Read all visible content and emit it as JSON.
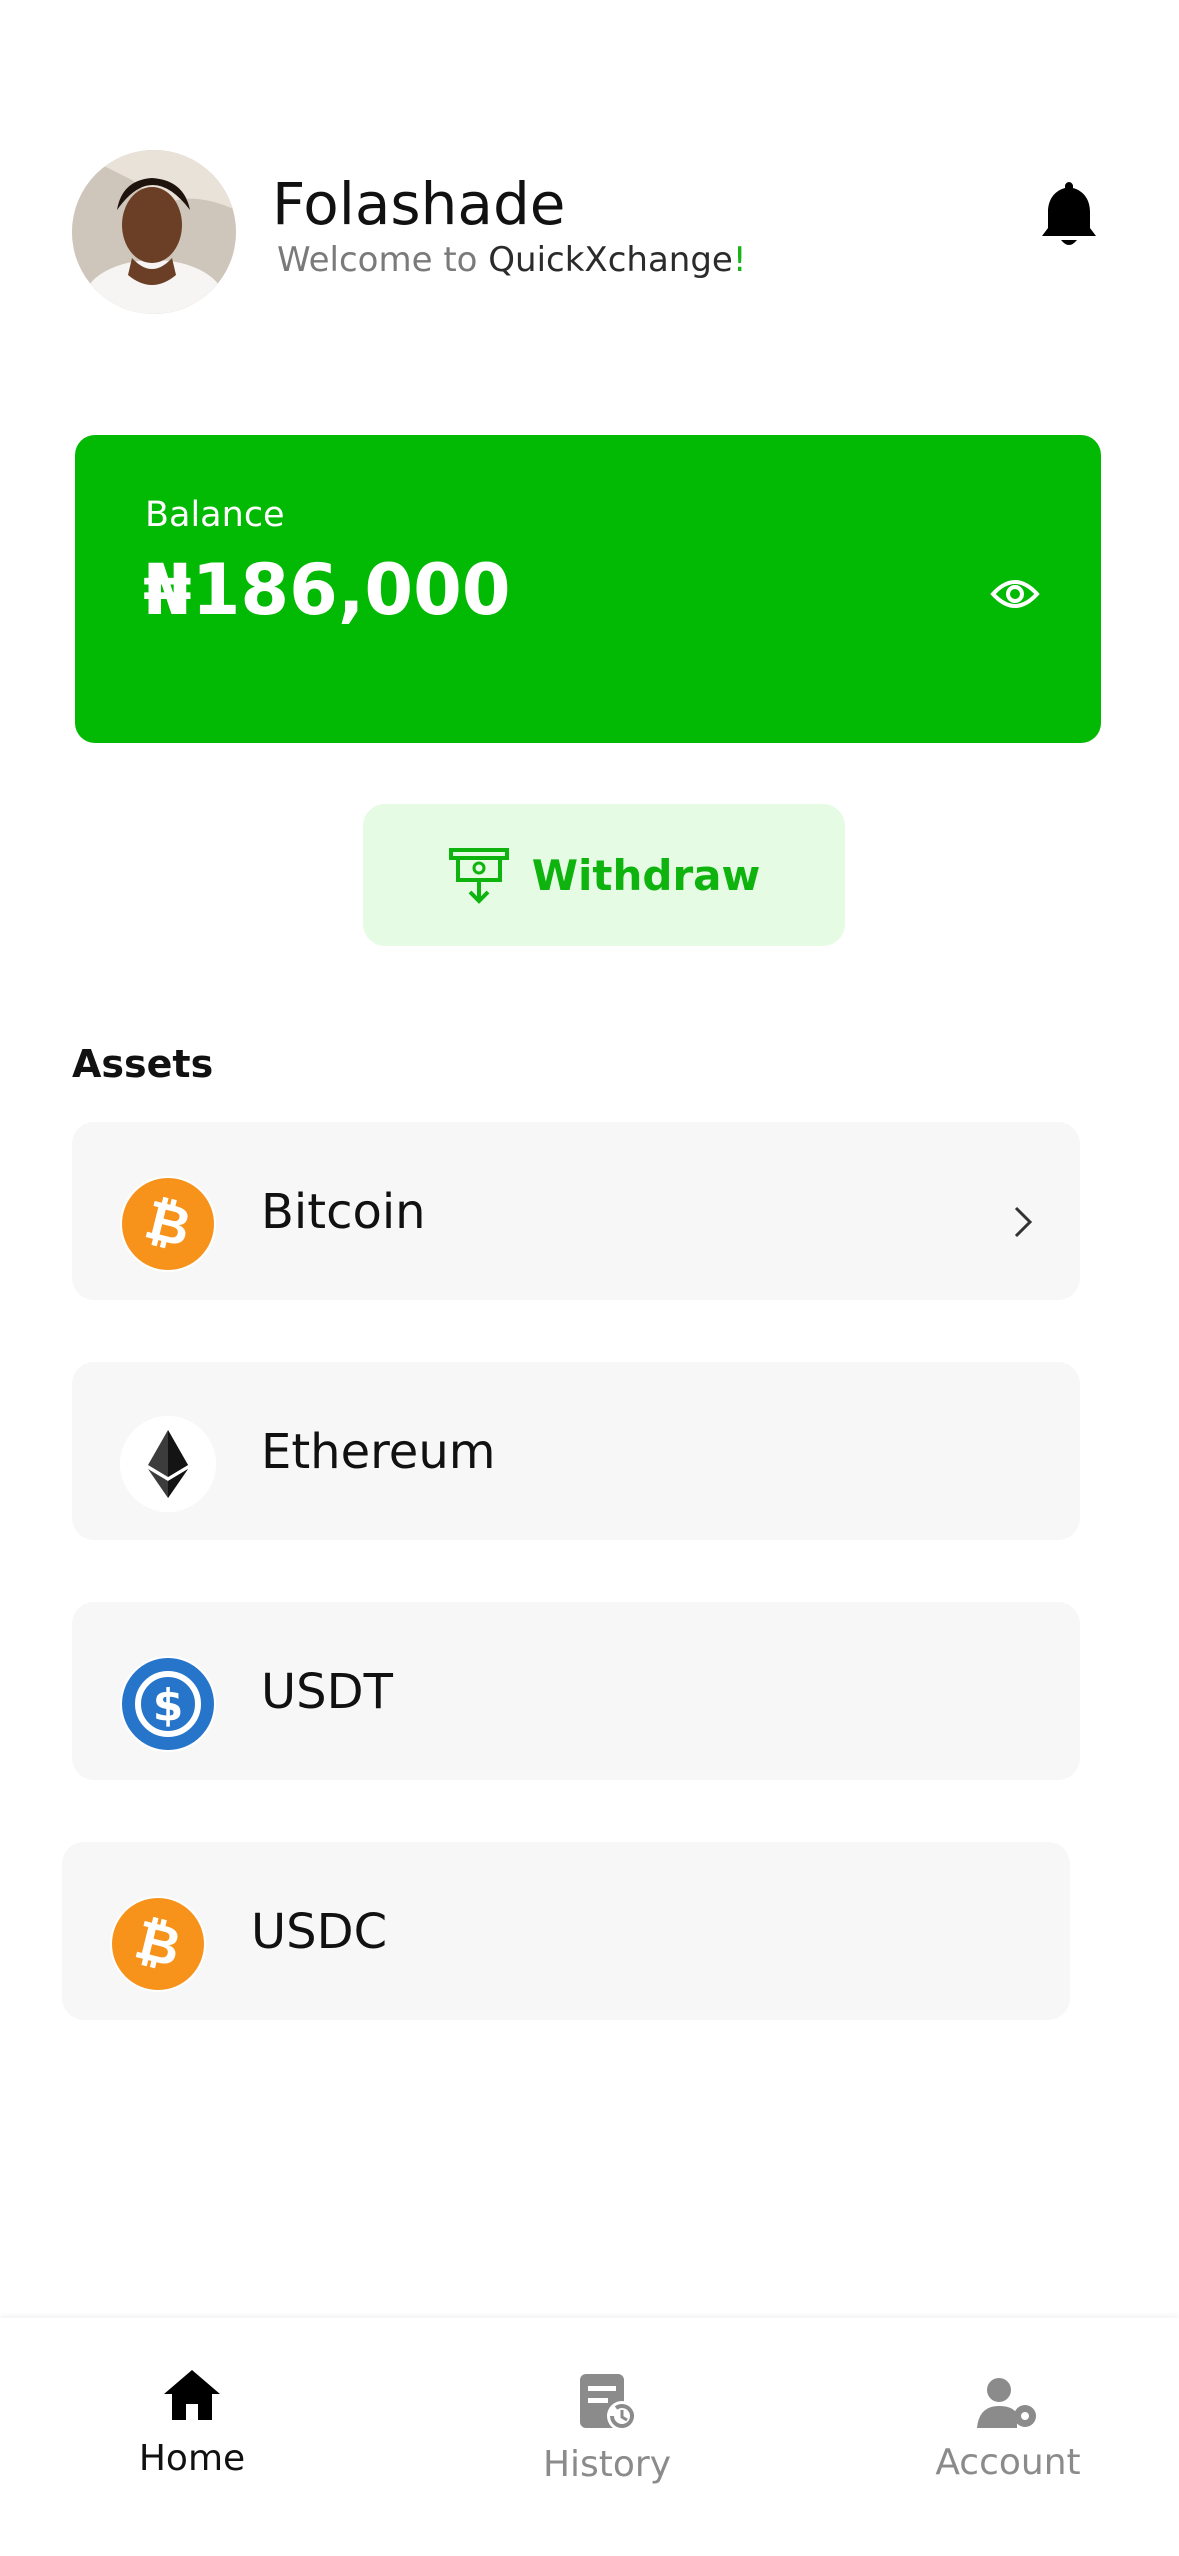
{
  "user": {
    "name": "Folashade",
    "welcome_prefix": "Welcome to ",
    "app_name": "QuickXchange",
    "exclamation": "!"
  },
  "balance": {
    "label": "Balance",
    "amount": "₦186,000"
  },
  "actions": {
    "withdraw_label": "Withdraw"
  },
  "assets": {
    "title": "Assets",
    "items": [
      {
        "name": "Bitcoin",
        "icon": "bitcoin-icon"
      },
      {
        "name": "Ethereum",
        "icon": "ethereum-icon"
      },
      {
        "name": "USDT",
        "icon": "usdc-coin-icon"
      },
      {
        "name": "USDC",
        "icon": "bitcoin-icon"
      }
    ]
  },
  "nav": {
    "tabs": [
      {
        "label": "Home",
        "icon": "home-icon",
        "active": true
      },
      {
        "label": "History",
        "icon": "history-icon",
        "active": false
      },
      {
        "label": "Account",
        "icon": "account-settings-icon",
        "active": false
      }
    ]
  },
  "colors": {
    "brand_green": "#02b903",
    "withdraw_bg": "#e6fbe4",
    "bitcoin_orange": "#f7931a",
    "usdc_blue": "#2775ca"
  }
}
